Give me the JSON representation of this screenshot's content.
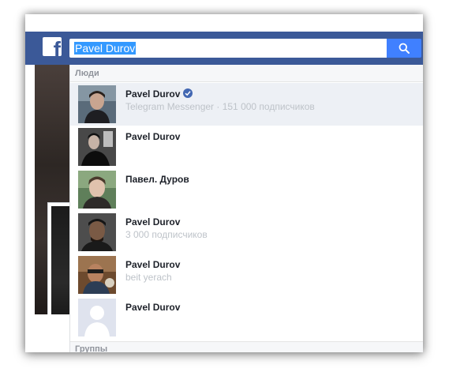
{
  "search": {
    "query": "Pavel Durov",
    "button_icon": "magnifier-icon"
  },
  "brand": {
    "logo_letter": "f",
    "color": "#3b5998"
  },
  "dropdown": {
    "people_header": "Люди",
    "groups_header": "Группы",
    "results": [
      {
        "name": "Pavel Durov",
        "verified": true,
        "subtitle": "Telegram Messenger · 151 000 подписчиков",
        "active": true
      },
      {
        "name": "Pavel Durov",
        "verified": false,
        "subtitle": ""
      },
      {
        "name": "Павел. Дуров",
        "verified": false,
        "subtitle": ""
      },
      {
        "name": "Pavel Durov",
        "verified": false,
        "subtitle": "3 000 подписчиков"
      },
      {
        "name": "Pavel Durov",
        "verified": false,
        "subtitle": "beit yerach"
      },
      {
        "name": "Pavel Durov",
        "verified": false,
        "subtitle": ""
      }
    ]
  }
}
